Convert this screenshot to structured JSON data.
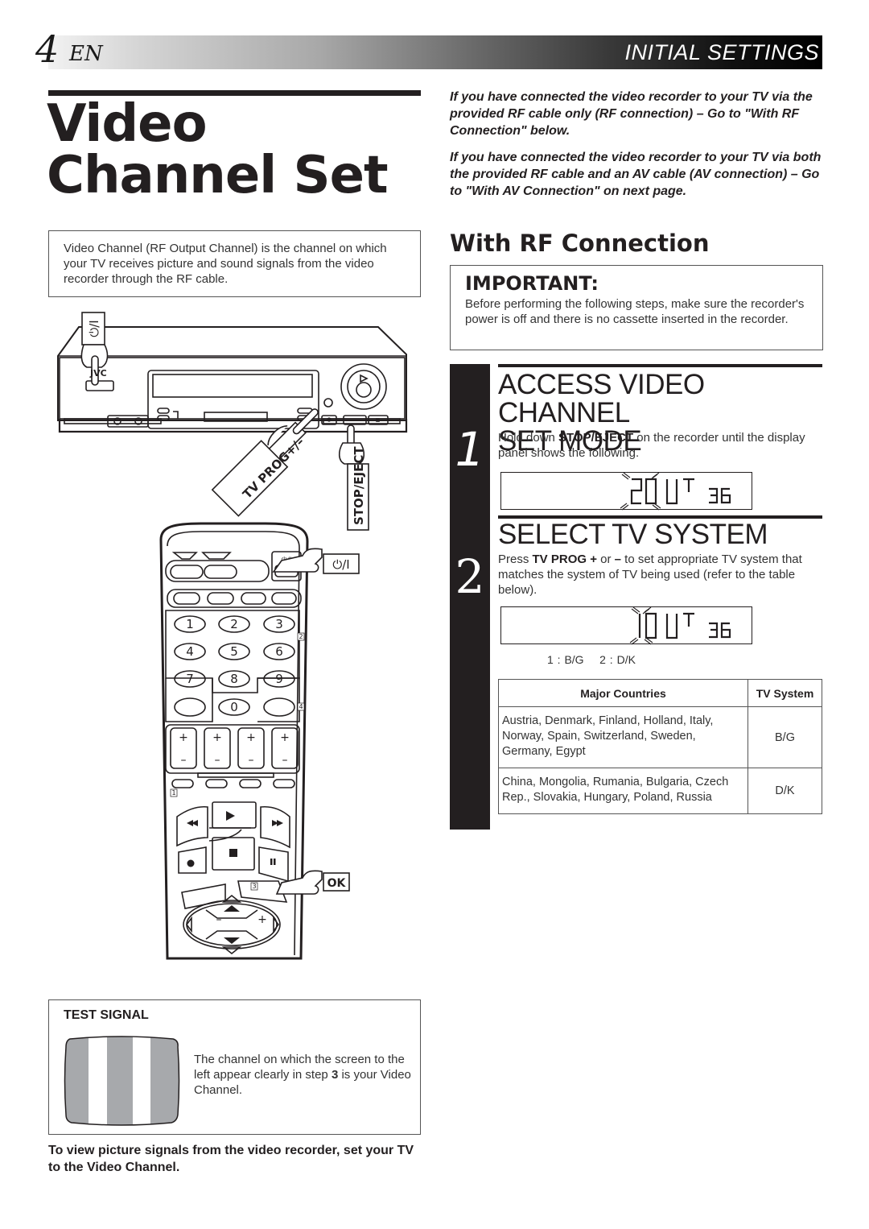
{
  "header": {
    "page_number": "4",
    "language": "EN",
    "section": "INITIAL SETTINGS"
  },
  "title": {
    "line1": "Video",
    "line2": "Channel Set"
  },
  "intro_box": {
    "text": "Video Channel (RF Output Channel) is the channel on which your TV receives picture and sound signals from the video recorder through the RF cable."
  },
  "illustration": {
    "brand": "JVC",
    "labels": {
      "power": "⏻/I",
      "tv_prog": "TV PROG+/–",
      "stop_eject": "STOP/EJECT",
      "remote_power": "⏻/I",
      "ok": "OK"
    },
    "remote_keypad": [
      "1",
      "2",
      "3",
      "4",
      "5",
      "6",
      "7",
      "8",
      "9",
      "0"
    ],
    "remote_markers": [
      "2",
      "4",
      "1",
      "3"
    ]
  },
  "test_signal": {
    "title": "TEST SIGNAL",
    "text_before": "The channel on which the screen to the left appear clearly in step ",
    "step_ref": "3",
    "text_after": " is your Video Channel."
  },
  "footer_note": "To view picture signals from the video recorder, set your TV to the Video Channel.",
  "right_intro": [
    "If you have connected the video recorder to your TV via the provided RF cable only (RF connection) – Go to \"With RF Connection\" below.",
    "If you have connected the video recorder to your TV via both the provided RF cable and an AV cable (AV connection) – Go to \"With AV Connection\" on next page."
  ],
  "rf_section": {
    "heading": "With RF Connection",
    "important_title": "IMPORTANT:",
    "important_text": "Before performing the following steps, make sure the recorder's power is off and there is no cassette inserted in the recorder."
  },
  "steps": [
    {
      "number": "1",
      "heading_line1": "ACCESS VIDEO CHANNEL",
      "heading_line2": "SET MODE",
      "text_before": "Hold down ",
      "text_bold": "STOP/EJECT",
      "text_after": " on the recorder until the display panel shows the following.",
      "display": {
        "blink": "2",
        "main": "OUT",
        "channel": "36"
      }
    },
    {
      "number": "2",
      "heading_line1": "SELECT TV SYSTEM",
      "text_before": "Press ",
      "text_bold": "TV PROG +",
      "text_mid": " or ",
      "text_bold2": "–",
      "text_after": " to set appropriate TV system that matches the system of TV being used (refer to the table below).",
      "display": {
        "blink": "1",
        "main": "OUT",
        "channel": "36"
      },
      "legend": "1 : B/G    2 : D/K"
    }
  ],
  "system_table": {
    "headers": [
      "Major Countries",
      "TV System"
    ],
    "rows": [
      {
        "countries": "Austria, Denmark, Finland, Holland, Italy, Norway, Spain, Switzerland, Sweden, Germany, Egypt",
        "system": "B/G"
      },
      {
        "countries": "China, Mongolia, Rumania, Bulgaria, Czech Rep., Slovakia, Hungary, Poland, Russia",
        "system": "D/K"
      }
    ]
  }
}
